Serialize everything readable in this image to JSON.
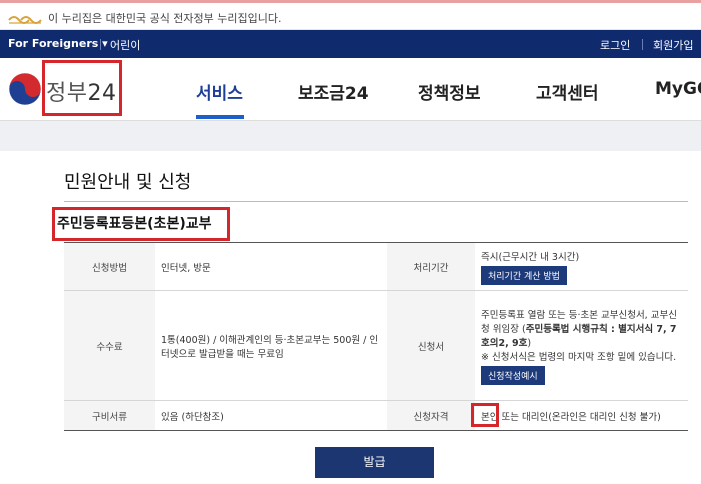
{
  "gov_notice": "이 누리집은 대한민국 공식 전자정부 누리집입니다.",
  "util": {
    "foreigners": "For Foreigners",
    "kids": "어린이",
    "login": "로그인",
    "join": "회원가입"
  },
  "brand": {
    "name": "정부",
    "num": "24"
  },
  "menu": [
    "서비스",
    "보조금24",
    "정책정보",
    "고객센터",
    "MyGO"
  ],
  "page_title": "민원안내 및 신청",
  "service_name": "주민등록표등본(초본)교부",
  "table": {
    "method_label": "신청방법",
    "method_value": "인터넷, 방문",
    "period_label": "처리기간",
    "period_value": "즉시(근무시간 내 3시간)",
    "period_button": "처리기간 계산 방법",
    "fee_label": "수수료",
    "fee_value": "1통(400원) / 이해관계인의 등·초본교부는 500원 / 인터넷으로 발급받을 때는 무료임",
    "form_label": "신청서",
    "form_text1": "주민등록표 열람 또는 등·초본 교부신청서, 교부신청 위임장 (",
    "form_text_bold": "주민등록법 시행규칙 : 별지서식 7, 7호의2, 9호",
    "form_text2": ")",
    "form_note": "※ 신청서식은 법령의 마지막 조항 밑에 있습니다.",
    "form_button": "신청작성예시",
    "docs_label": "구비서류",
    "docs_value": "있음 (하단참조)",
    "qual_label": "신청자격",
    "qual_self": "본인",
    "qual_rest": " 또는 대리인(온라인은 대리인 신청 불가)"
  },
  "apply_button": "발급",
  "colors": {
    "navy": "#102a6e",
    "accent": "#1d5ec9",
    "highlight": "#d4262b"
  }
}
